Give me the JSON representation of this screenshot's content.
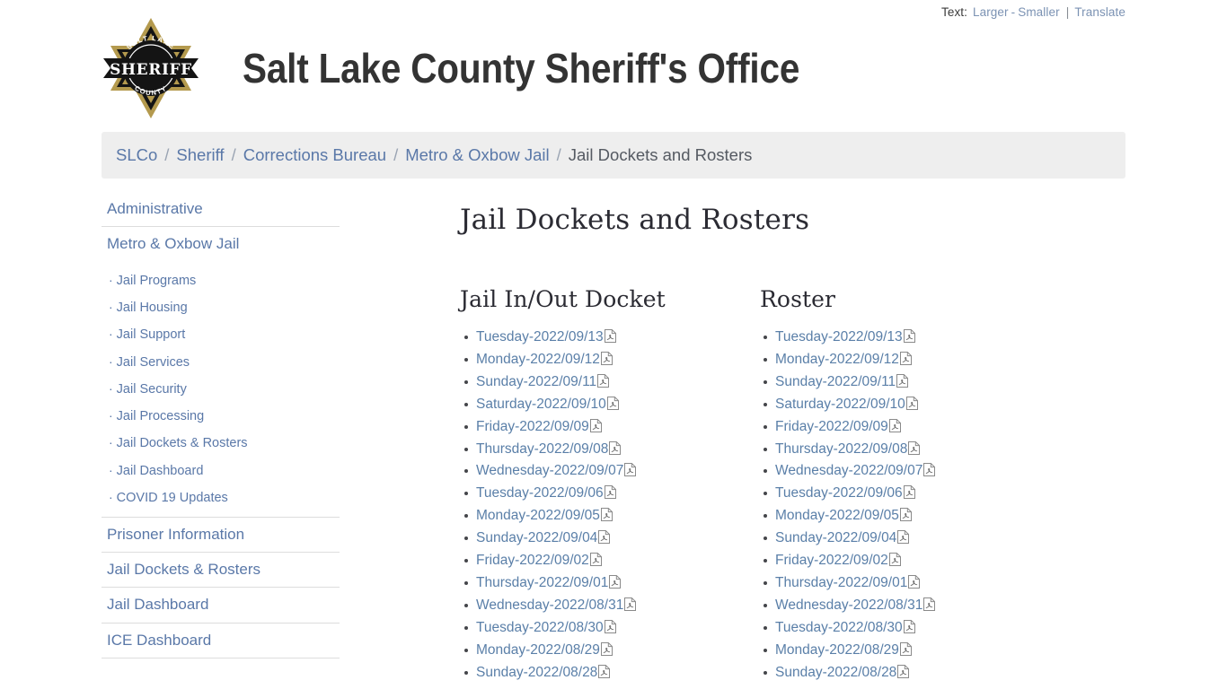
{
  "utility": {
    "label": "Text:",
    "larger": "Larger",
    "separator": "-",
    "smaller": "Smaller",
    "pipe": "|",
    "translate": "Translate"
  },
  "header": {
    "title": "Salt Lake County Sheriff's Office",
    "badge": {
      "icon": "sheriff-star-badge-icon",
      "banner_text": "SHERIFF",
      "arc_top_text": "SALT LAKE",
      "arc_bottom_text": "COUNTY",
      "gold": "#b49a4e",
      "black": "#141414"
    }
  },
  "breadcrumb": {
    "separator": "/",
    "items": [
      {
        "label": "SLCo",
        "current": false
      },
      {
        "label": "Sheriff",
        "current": false
      },
      {
        "label": "Corrections Bureau",
        "current": false
      },
      {
        "label": "Metro & Oxbow Jail",
        "current": false
      },
      {
        "label": "Jail Dockets and Rosters",
        "current": true
      }
    ]
  },
  "sidebar": {
    "administrative": "Administrative",
    "section_title": "Metro & Oxbow Jail",
    "bullet": "·",
    "sub_items": [
      "Jail Programs",
      "Jail Housing",
      "Jail Support",
      "Jail Services",
      "Jail Security",
      "Jail Processing",
      "Jail Dockets & Rosters",
      "Jail Dashboard",
      "COVID 19 Updates"
    ],
    "groups": [
      "Prisoner Information",
      "Jail Dockets & Rosters",
      "Jail Dashboard",
      "ICE Dashboard"
    ]
  },
  "main": {
    "page_title": "Jail Dockets and Rosters",
    "columns": [
      {
        "heading": "Jail In/Out Docket",
        "items": [
          "Tuesday-2022/09/13",
          "Monday-2022/09/12",
          "Sunday-2022/09/11",
          "Saturday-2022/09/10",
          "Friday-2022/09/09",
          "Thursday-2022/09/08",
          "Wednesday-2022/09/07",
          "Tuesday-2022/09/06",
          "Monday-2022/09/05",
          "Sunday-2022/09/04",
          "Friday-2022/09/02",
          "Thursday-2022/09/01",
          "Wednesday-2022/08/31",
          "Tuesday-2022/08/30",
          "Monday-2022/08/29",
          "Sunday-2022/08/28"
        ]
      },
      {
        "heading": "Roster",
        "items": [
          "Tuesday-2022/09/13",
          "Monday-2022/09/12",
          "Sunday-2022/09/11",
          "Saturday-2022/09/10",
          "Friday-2022/09/09",
          "Thursday-2022/09/08",
          "Wednesday-2022/09/07",
          "Tuesday-2022/09/06",
          "Monday-2022/09/05",
          "Sunday-2022/09/04",
          "Friday-2022/09/02",
          "Thursday-2022/09/01",
          "Wednesday-2022/08/31",
          "Tuesday-2022/08/30",
          "Monday-2022/08/29",
          "Sunday-2022/08/28"
        ]
      }
    ],
    "file_icon": "pdf-file-icon"
  },
  "colors": {
    "link": "#5a7fa8",
    "breadcrumb_bg": "#eeeeee",
    "title_text": "#333333"
  }
}
